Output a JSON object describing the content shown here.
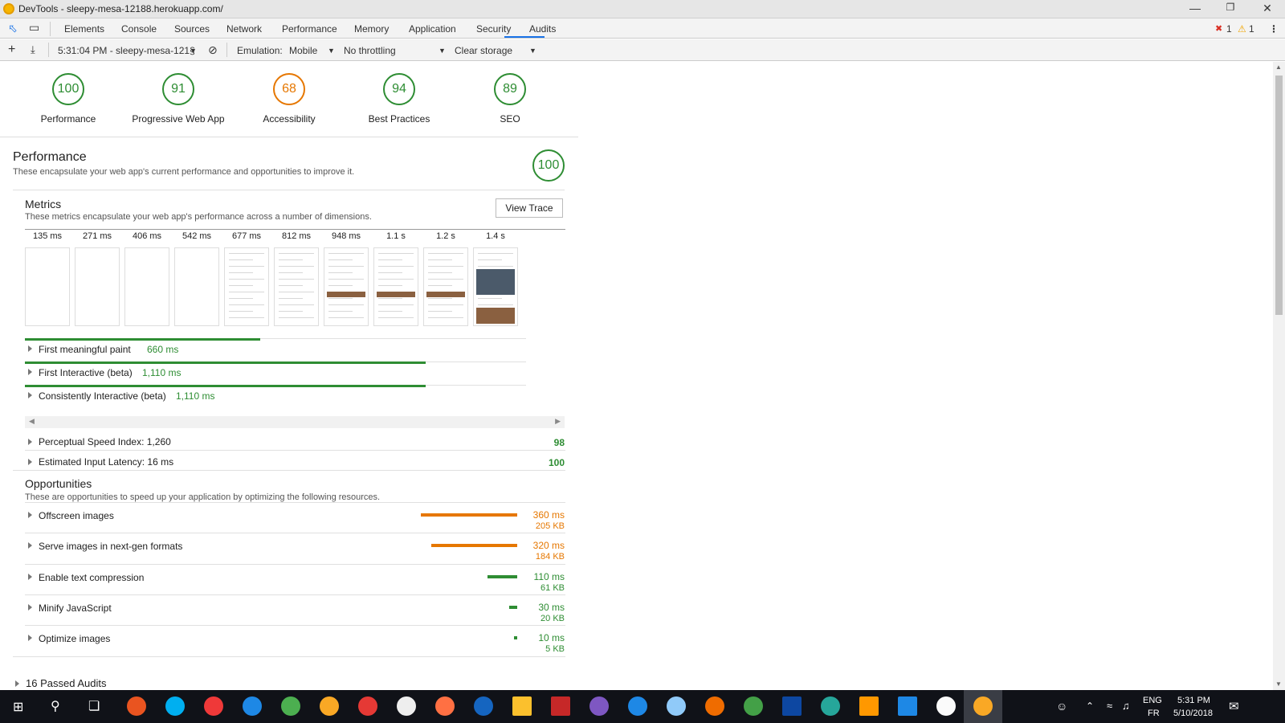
{
  "window": {
    "title": "DevTools - sleepy-mesa-12188.herokuapp.com/"
  },
  "tabs": [
    "Elements",
    "Console",
    "Sources",
    "Network",
    "Performance",
    "Memory",
    "Application",
    "Security",
    "Audits"
  ],
  "tab_selected": "Audits",
  "status": {
    "errors": "1",
    "warnings": "1"
  },
  "toolbar": {
    "report_name": "5:31:04 PM - sleepy-mesa-121§",
    "emulation_label": "Emulation:",
    "emulation_value": "Mobile",
    "throttling": "No throttling",
    "storage": "Clear storage"
  },
  "scores": [
    {
      "value": "100",
      "label": "Performance"
    },
    {
      "value": "91",
      "label": "Progressive Web App"
    },
    {
      "value": "68",
      "label": "Accessibility"
    },
    {
      "value": "94",
      "label": "Best Practices"
    },
    {
      "value": "89",
      "label": "SEO"
    }
  ],
  "performance": {
    "title": "Performance",
    "description": "These encapsulate your web app's current performance and opportunities to improve it.",
    "score": "100"
  },
  "metrics": {
    "title": "Metrics",
    "description": "These metrics encapsulate your web app's performance across a number of dimensions.",
    "view_trace": "View Trace",
    "filmstrip_times": [
      "135 ms",
      "271 ms",
      "406 ms",
      "542 ms",
      "677 ms",
      "812 ms",
      "948 ms",
      "1.1 s",
      "1.2 s",
      "1.4 s"
    ],
    "items": [
      {
        "label": "First meaningful paint",
        "value": "660 ms",
        "bar_fraction": 0.47
      },
      {
        "label": "First Interactive (beta)",
        "value": "1,110 ms",
        "bar_fraction": 0.8
      },
      {
        "label": "Consistently Interactive (beta)",
        "value": "1,110 ms",
        "bar_fraction": 0.8
      }
    ],
    "scored": [
      {
        "label": "Perceptual Speed Index: 1,260",
        "score": "98"
      },
      {
        "label": "Estimated Input Latency: 16 ms",
        "score": "100"
      }
    ]
  },
  "opportunities": {
    "title": "Opportunities",
    "description": "These are opportunities to speed up your application by optimizing the following resources.",
    "items": [
      {
        "label": "Offscreen images",
        "time": "360 ms",
        "size": "205 KB",
        "fraction": 1.0,
        "color": "#e67700"
      },
      {
        "label": "Serve images in next-gen formats",
        "time": "320 ms",
        "size": "184 KB",
        "fraction": 0.89,
        "color": "#e67700"
      },
      {
        "label": "Enable text compression",
        "time": "110 ms",
        "size": "61 KB",
        "fraction": 0.31,
        "color": "#2e8d33"
      },
      {
        "label": "Minify JavaScript",
        "time": "30 ms",
        "size": "20 KB",
        "fraction": 0.08,
        "color": "#2e8d33"
      },
      {
        "label": "Optimize images",
        "time": "10 ms",
        "size": "5 KB",
        "fraction": 0.03,
        "color": "#2e8d33"
      }
    ]
  },
  "passed": {
    "label": "16 Passed Audits"
  },
  "tray": {
    "lang1": "ENG",
    "lang2": "FR",
    "time": "5:31 PM",
    "date": "5/10/2018"
  }
}
